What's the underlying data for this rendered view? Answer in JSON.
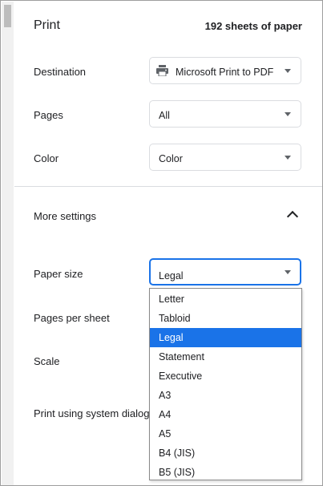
{
  "header": {
    "title": "Print",
    "sheets": "192 sheets of paper"
  },
  "settings": {
    "destination": {
      "label": "Destination",
      "value": "Microsoft Print to PDF",
      "icon": "printer-icon"
    },
    "pages": {
      "label": "Pages",
      "value": "All"
    },
    "color": {
      "label": "Color",
      "value": "Color"
    }
  },
  "more_settings": {
    "label": "More settings",
    "icon": "chevron-up-icon"
  },
  "advanced": {
    "paper_size": {
      "label": "Paper size",
      "value": "Legal"
    },
    "pages_per_sheet": {
      "label": "Pages per sheet"
    },
    "scale": {
      "label": "Scale"
    },
    "system_dialog": {
      "label": "Print using system dialog"
    }
  },
  "dropdown": {
    "options": [
      "Letter",
      "Tabloid",
      "Legal",
      "Statement",
      "Executive",
      "A3",
      "A4",
      "A5",
      "B4 (JIS)",
      "B5 (JIS)"
    ],
    "selected_index": 2,
    "selected_color": "#1a73e8"
  },
  "colors": {
    "accent": "#1a73e8",
    "border": "#dadce0",
    "text": "#202124"
  }
}
